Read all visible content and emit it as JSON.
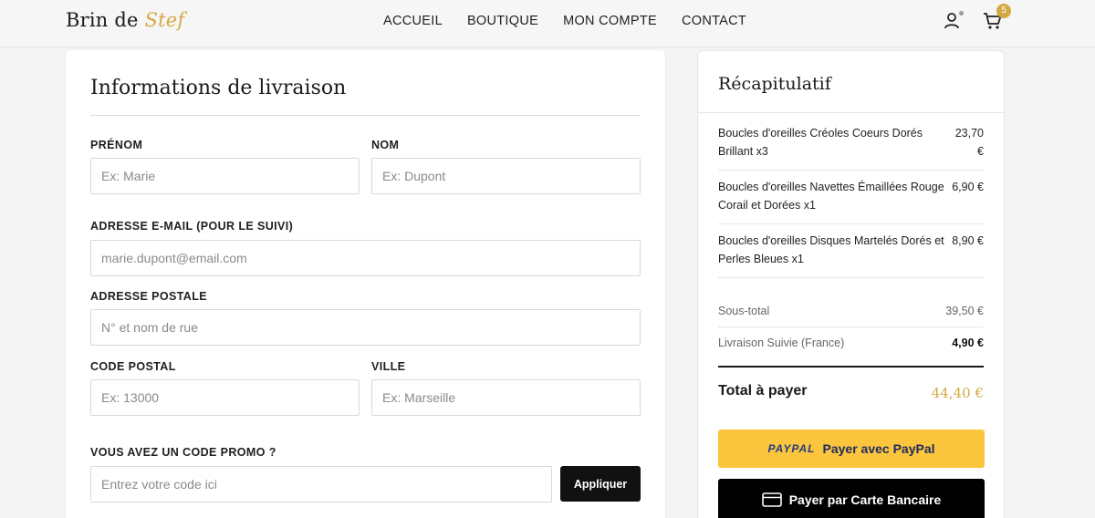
{
  "header": {
    "logo_main": "Brin de",
    "logo_accent": "Stef",
    "nav": [
      "ACCUEIL",
      "BOUTIQUE",
      "MON COMPTE",
      "CONTACT"
    ],
    "cart_count": "5",
    "icons": [
      "user-icon",
      "cart-icon"
    ]
  },
  "form": {
    "title": "Informations de livraison",
    "firstname_label": "PRÉNOM",
    "firstname_placeholder": "Ex: Marie",
    "lastname_label": "NOM",
    "lastname_placeholder": "Ex: Dupont",
    "email_label": "ADRESSE E-MAIL (POUR LE SUIVI)",
    "email_placeholder": "marie.dupont@email.com",
    "address_label": "ADRESSE POSTALE",
    "address_placeholder": "N° et nom de rue",
    "zip_label": "CODE POSTAL",
    "zip_placeholder": "Ex: 13000",
    "city_label": "VILLE",
    "city_placeholder": "Ex: Marseille",
    "promo_label": "VOUS AVEZ UN CODE PROMO ?",
    "promo_placeholder": "Entrez votre code ici",
    "apply_label": "Appliquer"
  },
  "summary": {
    "title": "Récapitulatif",
    "items": [
      {
        "name": "Boucles d'oreilles Créoles Coeurs Dorés Brillant x3",
        "price": "23,70 €"
      },
      {
        "name": "Boucles d'oreilles Navettes Émaillées Rouge Corail et Dorées x1",
        "price": "6,90 €"
      },
      {
        "name": "Boucles d'oreilles Disques Martelés Dorés et Perles Bleues x1",
        "price": "8,90 €"
      }
    ],
    "subtotal_label": "Sous-total",
    "subtotal_value": "39,50 €",
    "shipping_label": "Livraison Suivie (France)",
    "shipping_value": "4,90 €",
    "total_label": "Total à payer",
    "total_value": "44,40 €",
    "paypal_mark": "PAYPAL",
    "paypal_label": "Payer avec PayPal",
    "card_label": "Payer par Carte Bancaire",
    "colors": {
      "accent": "#d4a843",
      "paypal": "#fbc53d",
      "card": "#000000"
    }
  }
}
